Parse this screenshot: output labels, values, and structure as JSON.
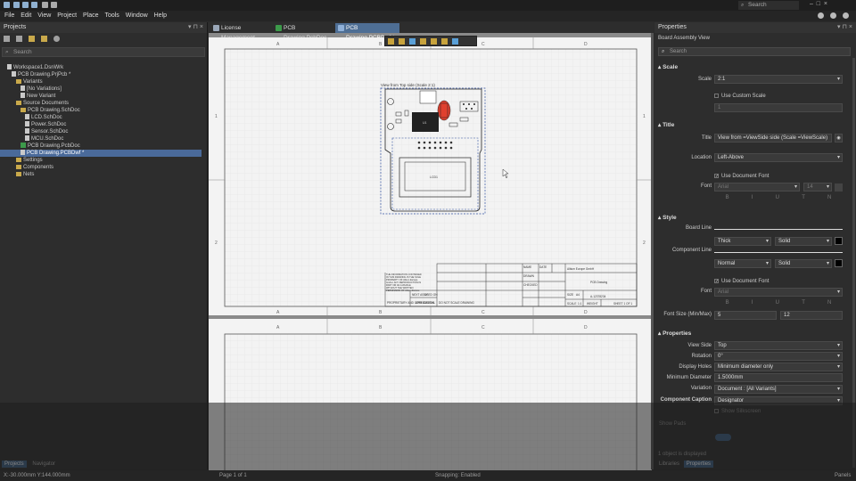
{
  "topbar": {
    "search_placeholder": "Search"
  },
  "menu": [
    "File",
    "Edit",
    "View",
    "Project",
    "Place",
    "Tools",
    "Window",
    "Help"
  ],
  "projects": {
    "title": "Projects",
    "search_placeholder": "Search",
    "tree": [
      {
        "label": "Workspace1.DsnWrk",
        "indent": 0,
        "icon": "doc",
        "selected": false
      },
      {
        "label": "PCB Drawing.PrjPcb *",
        "indent": 1,
        "icon": "doc",
        "selected": false
      },
      {
        "label": "Variants",
        "indent": 2,
        "icon": "fold",
        "selected": false
      },
      {
        "label": "[No Variations]",
        "indent": 3,
        "icon": "doc",
        "selected": false
      },
      {
        "label": "New Variant",
        "indent": 3,
        "icon": "doc",
        "selected": false
      },
      {
        "label": "Source Documents",
        "indent": 2,
        "icon": "fold",
        "selected": false
      },
      {
        "label": "PCB Drawing.SchDoc",
        "indent": 3,
        "icon": "fold",
        "selected": false
      },
      {
        "label": "LCD.SchDoc",
        "indent": 4,
        "icon": "doc",
        "selected": false
      },
      {
        "label": "Power.SchDoc",
        "indent": 4,
        "icon": "doc",
        "selected": false
      },
      {
        "label": "Sensor.SchDoc",
        "indent": 4,
        "icon": "doc",
        "selected": false
      },
      {
        "label": "MCU.SchDoc",
        "indent": 4,
        "icon": "doc",
        "selected": false
      },
      {
        "label": "PCB Drawing.PcbDoc",
        "indent": 3,
        "icon": "pcb",
        "selected": false
      },
      {
        "label": "PCB Drawing.PCBDwf *",
        "indent": 3,
        "icon": "doc",
        "selected": true
      },
      {
        "label": "Settings",
        "indent": 2,
        "icon": "fold",
        "selected": false
      },
      {
        "label": "Components",
        "indent": 2,
        "icon": "fold",
        "selected": false
      },
      {
        "label": "Nets",
        "indent": 2,
        "icon": "fold",
        "selected": false
      }
    ],
    "tabs": [
      "Projects",
      "Navigator"
    ]
  },
  "doc_tabs": [
    {
      "label": "License Management",
      "color": "#9aa7b8",
      "active": false
    },
    {
      "label": "PCB Drawing.PcbDoc",
      "color": "#3c9a4a",
      "active": false
    },
    {
      "label": "PCB Drawing.PCBDwf *",
      "color": "#5c8cc4",
      "active": true
    }
  ],
  "drawing": {
    "col_labels": [
      "A",
      "B",
      "C",
      "D"
    ],
    "row_labels": [
      "1",
      "2"
    ],
    "view_caption": "View from Top side (Scale 2:1)",
    "lcd_label": "LCD1",
    "ic_label": "U1",
    "title_block": {
      "company": "Altium Europe GmbH",
      "title": "PCB Drawing",
      "doc_number": "A-12378234",
      "scale_label": "SCALE",
      "scale_value": "1:1",
      "weight_label": "WEIGHT",
      "sheet": "SHEET 1 OF 1",
      "size_label": "SIZE",
      "size_value": "A4",
      "notice": "THE INFORMATION CONTAINED IN THIS DRAWING IS THE SOLE PROPERTY OF Altium Europe GmbH. ANY REPRODUCTION IN PART OR AS A WHOLE WITHOUT THE WRITTEN PERMISSION OF Altium Europe GmbH IS PROHIBITED.",
      "prop": "PROPRIETARY AND CONFIDENTIAL",
      "next_asy": "NEXT ASSY",
      "used_on": "USED ON",
      "application": "APPLICATION",
      "do_not_scale": "DO NOT SCALE DRAWING",
      "drawn": "DRAWN",
      "checked": "CHECKED",
      "name": "NAME",
      "date": "DATE"
    }
  },
  "properties": {
    "title": "Properties",
    "search_placeholder": "Search",
    "subtitle": "Board Assembly View",
    "scale_section": "Scale",
    "scale_label": "Scale",
    "scale_value": "2:1",
    "use_custom_scale": "Use Custom Scale",
    "custom_scale_value": "1",
    "title_section": "Title",
    "title_label": "Title",
    "title_value": "View from =ViewSide side (Scale =ViewScale)",
    "location_label": "Location",
    "location_value": "Left-Above",
    "use_document_font": "Use Document Font",
    "font_label": "Font",
    "font_value": "Arial",
    "font_size": "14",
    "font_buttons": [
      "B",
      "I",
      "U",
      "T",
      "N"
    ],
    "style_section": "Style",
    "board_line_label": "Board Line",
    "board_line_weight": "Thick",
    "board_line_style": "Solid",
    "component_line_label": "Component Line",
    "component_line_weight": "Normal",
    "component_line_style": "Solid",
    "style_font_label": "Font",
    "style_use_document_font": "Use Document Font",
    "style_font_value": "Arial",
    "font_size_minmax_label": "Font Size (Min/Max)",
    "font_min": "5",
    "font_max": "12",
    "properties_section": "Properties",
    "view_side_label": "View Side",
    "view_side_value": "Top",
    "rotation_label": "Rotation",
    "rotation_value": "0°",
    "display_holes_label": "Display Holes",
    "display_holes_value": "Minimum diameter only",
    "min_diameter_label": "Minimum Diameter",
    "min_diameter_value": "1.5000mm",
    "variation_label": "Variation",
    "variation_value": "Document : [All Variants]",
    "component_caption_label": "Component Caption",
    "component_caption_value": "Designator",
    "show_silkscreen": "Show Silkscreen",
    "show_pads": "Show Pads",
    "objects_displayed": "1 object is displayed",
    "tabs": [
      "Libraries",
      "Properties"
    ]
  },
  "status": {
    "coords": "X:-30.000mm Y:144.000mm",
    "page": "Page 1 of 1",
    "snapping": "Snapping: Enabled",
    "panels": "Panels"
  },
  "colors": {
    "accent": "#4e6e94",
    "selected": "#4a6a9a",
    "sheet": "#f3f3f3",
    "highlight": "#e0402e"
  }
}
